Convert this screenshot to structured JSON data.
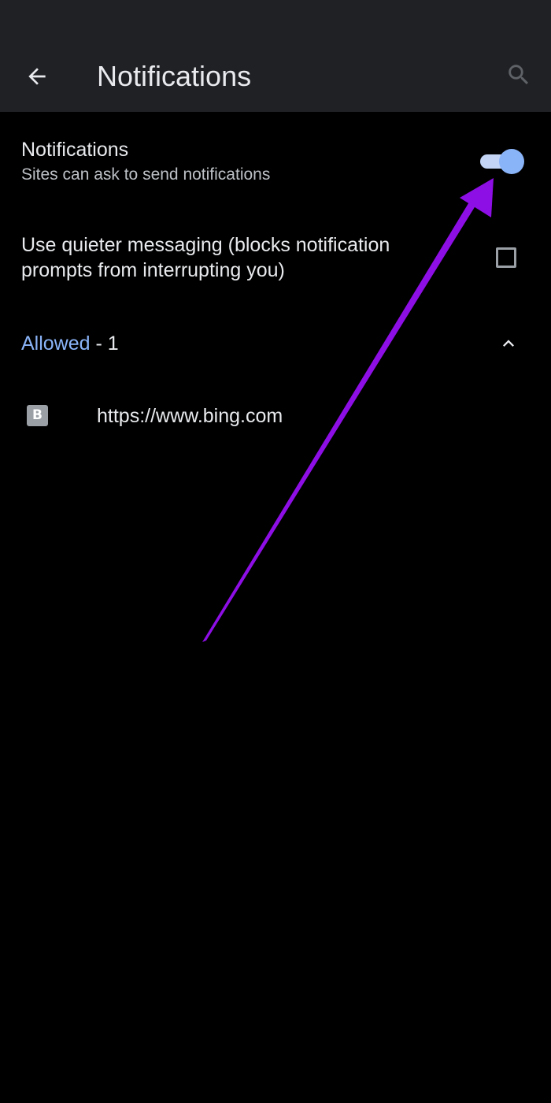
{
  "app_bar": {
    "title": "Notifications",
    "back_icon": "arrow-left-icon",
    "search_icon": "search-icon"
  },
  "notifications_setting": {
    "title": "Notifications",
    "subtitle": "Sites can ask to send notifications",
    "enabled": true
  },
  "quiet_messaging": {
    "label": "Use quieter messaging (blocks notification prompts from interrupting you)",
    "checked": false
  },
  "allowed_section": {
    "label": "Allowed",
    "count_text": " - 1",
    "expanded": true
  },
  "sites": [
    {
      "favicon_letter": "B",
      "url": "https://www.bing.com"
    }
  ],
  "colors": {
    "background": "#000000",
    "app_bar": "#202124",
    "accent": "#8ab4f8",
    "annotation_arrow": "#8e0ee6"
  }
}
